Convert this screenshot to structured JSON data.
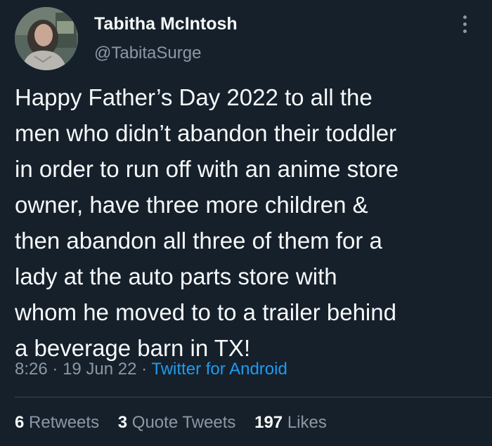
{
  "author": {
    "name": "Tabitha McIntosh",
    "handle": "@TabitaSurge"
  },
  "tweet": {
    "lines": [
      "Happy Father’s Day 2022 to all the",
      "men who didn’t abandon their toddler",
      "in order to run off with an anime store",
      "owner, have three more children &",
      "then abandon all three of them for a",
      "lady at the auto parts store with",
      "whom he moved to to a trailer behind",
      "a beverage barn in TX!"
    ],
    "time": "8:26",
    "separator": "·",
    "date": "19 Jun 22",
    "source": "Twitter for Android"
  },
  "stats": {
    "retweets_count": "6",
    "retweets_label": "Retweets",
    "quotes_count": "3",
    "quotes_label": "Quote Tweets",
    "likes_count": "197",
    "likes_label": "Likes"
  },
  "colors": {
    "background": "#15202b",
    "text": "#f7f9f9",
    "secondary": "#8b98a5",
    "accent": "#1d9bf0",
    "divider": "#38444d"
  },
  "icons": {
    "more": "more-vertical-icon"
  }
}
